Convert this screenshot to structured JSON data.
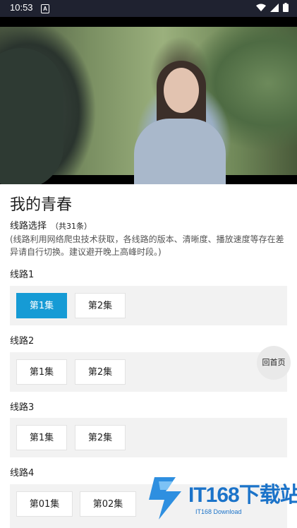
{
  "status_bar": {
    "time": "10:53",
    "notification_glyph": "A",
    "icons": [
      "wifi-icon",
      "signal-icon",
      "battery-icon"
    ]
  },
  "video": {
    "description_icon": "video-frame"
  },
  "title": "我的青春",
  "routes": {
    "label": "线路选择",
    "count": "（共31条）",
    "note": "(线路利用网络爬虫技术获取，各线路的版本、清晰度、播放速度等存在差异请自行切换。建议避开晚上高峰时段。)"
  },
  "lines": [
    {
      "label": "线路1",
      "episodes": [
        "第1集",
        "第2集"
      ],
      "active": 0
    },
    {
      "label": "线路2",
      "episodes": [
        "第1集",
        "第2集"
      ]
    },
    {
      "label": "线路3",
      "episodes": [
        "第1集",
        "第2集"
      ]
    },
    {
      "label": "线路4",
      "episodes": [
        "第01集",
        "第02集"
      ]
    }
  ],
  "home_button": "回首页",
  "watermark": {
    "text": "IT168下载站",
    "sub": "IT168 Download"
  },
  "colors": {
    "accent": "#169bd5",
    "status_bar": "#1f2230",
    "panel": "#f2f2f2"
  }
}
